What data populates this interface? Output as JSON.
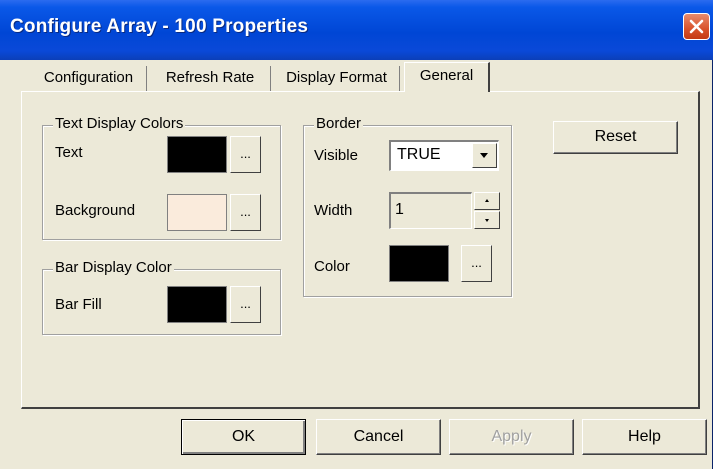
{
  "window": {
    "title": "Configure Array - 100 Properties",
    "close_icon": "close-icon"
  },
  "tabs": [
    {
      "label": "Configuration",
      "active": false
    },
    {
      "label": "Refresh Rate",
      "active": false
    },
    {
      "label": "Display Format",
      "active": false
    },
    {
      "label": "General",
      "active": true
    }
  ],
  "text_colors": {
    "title": "Text Display Colors",
    "text_label": "Text",
    "text_color": "#000000",
    "background_label": "Background",
    "background_color": "#faebdc",
    "browse_label": "..."
  },
  "bar_color": {
    "title": "Bar Display Color",
    "fill_label": "Bar Fill",
    "fill_color": "#000000",
    "browse_label": "..."
  },
  "border": {
    "title": "Border",
    "visible_label": "Visible",
    "visible_value": "TRUE",
    "width_label": "Width",
    "width_value": "1",
    "color_label": "Color",
    "color_value": "#000000",
    "browse_label": "..."
  },
  "reset_label": "Reset",
  "footer": {
    "ok_label": "OK",
    "cancel_label": "Cancel",
    "apply_label": "Apply",
    "help_label": "Help"
  }
}
